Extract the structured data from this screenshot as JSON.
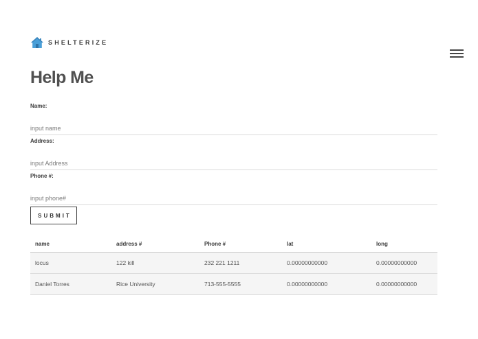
{
  "brand": {
    "name": "SHELTERIZE",
    "icon": "house-icon",
    "icon_color": "#4a9fd8"
  },
  "header": {
    "menu_icon": "hamburger-menu-icon"
  },
  "page": {
    "title": "Help Me"
  },
  "form": {
    "fields": [
      {
        "label": "Name:",
        "placeholder": "input name",
        "value": ""
      },
      {
        "label": "Address:",
        "placeholder": "input Address",
        "value": ""
      },
      {
        "label": "Phone #:",
        "placeholder": "input phone#",
        "value": ""
      }
    ],
    "submit_label": "SUBMIT"
  },
  "table": {
    "headers": [
      "name",
      "address #",
      "Phone #",
      "lat",
      "long"
    ],
    "rows": [
      [
        "locus",
        "122 kill",
        "232 221 1211",
        "0.00000000000",
        "0.00000000000"
      ],
      [
        "Daniel Torres",
        "Rice University",
        "713-555-5555",
        "0.00000000000",
        "0.00000000000"
      ]
    ]
  }
}
